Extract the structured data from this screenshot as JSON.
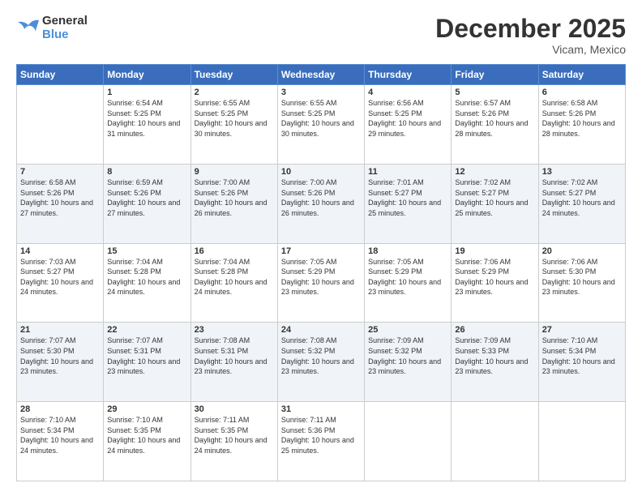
{
  "header": {
    "logo_general": "General",
    "logo_blue": "Blue",
    "month_title": "December 2025",
    "location": "Vicam, Mexico"
  },
  "days_of_week": [
    "Sunday",
    "Monday",
    "Tuesday",
    "Wednesday",
    "Thursday",
    "Friday",
    "Saturday"
  ],
  "weeks": [
    [
      {
        "day": "",
        "sunrise": "",
        "sunset": "",
        "daylight": ""
      },
      {
        "day": "1",
        "sunrise": "Sunrise: 6:54 AM",
        "sunset": "Sunset: 5:25 PM",
        "daylight": "Daylight: 10 hours and 31 minutes."
      },
      {
        "day": "2",
        "sunrise": "Sunrise: 6:55 AM",
        "sunset": "Sunset: 5:25 PM",
        "daylight": "Daylight: 10 hours and 30 minutes."
      },
      {
        "day": "3",
        "sunrise": "Sunrise: 6:55 AM",
        "sunset": "Sunset: 5:25 PM",
        "daylight": "Daylight: 10 hours and 30 minutes."
      },
      {
        "day": "4",
        "sunrise": "Sunrise: 6:56 AM",
        "sunset": "Sunset: 5:25 PM",
        "daylight": "Daylight: 10 hours and 29 minutes."
      },
      {
        "day": "5",
        "sunrise": "Sunrise: 6:57 AM",
        "sunset": "Sunset: 5:26 PM",
        "daylight": "Daylight: 10 hours and 28 minutes."
      },
      {
        "day": "6",
        "sunrise": "Sunrise: 6:58 AM",
        "sunset": "Sunset: 5:26 PM",
        "daylight": "Daylight: 10 hours and 28 minutes."
      }
    ],
    [
      {
        "day": "7",
        "sunrise": "Sunrise: 6:58 AM",
        "sunset": "Sunset: 5:26 PM",
        "daylight": "Daylight: 10 hours and 27 minutes."
      },
      {
        "day": "8",
        "sunrise": "Sunrise: 6:59 AM",
        "sunset": "Sunset: 5:26 PM",
        "daylight": "Daylight: 10 hours and 27 minutes."
      },
      {
        "day": "9",
        "sunrise": "Sunrise: 7:00 AM",
        "sunset": "Sunset: 5:26 PM",
        "daylight": "Daylight: 10 hours and 26 minutes."
      },
      {
        "day": "10",
        "sunrise": "Sunrise: 7:00 AM",
        "sunset": "Sunset: 5:26 PM",
        "daylight": "Daylight: 10 hours and 26 minutes."
      },
      {
        "day": "11",
        "sunrise": "Sunrise: 7:01 AM",
        "sunset": "Sunset: 5:27 PM",
        "daylight": "Daylight: 10 hours and 25 minutes."
      },
      {
        "day": "12",
        "sunrise": "Sunrise: 7:02 AM",
        "sunset": "Sunset: 5:27 PM",
        "daylight": "Daylight: 10 hours and 25 minutes."
      },
      {
        "day": "13",
        "sunrise": "Sunrise: 7:02 AM",
        "sunset": "Sunset: 5:27 PM",
        "daylight": "Daylight: 10 hours and 24 minutes."
      }
    ],
    [
      {
        "day": "14",
        "sunrise": "Sunrise: 7:03 AM",
        "sunset": "Sunset: 5:27 PM",
        "daylight": "Daylight: 10 hours and 24 minutes."
      },
      {
        "day": "15",
        "sunrise": "Sunrise: 7:04 AM",
        "sunset": "Sunset: 5:28 PM",
        "daylight": "Daylight: 10 hours and 24 minutes."
      },
      {
        "day": "16",
        "sunrise": "Sunrise: 7:04 AM",
        "sunset": "Sunset: 5:28 PM",
        "daylight": "Daylight: 10 hours and 24 minutes."
      },
      {
        "day": "17",
        "sunrise": "Sunrise: 7:05 AM",
        "sunset": "Sunset: 5:29 PM",
        "daylight": "Daylight: 10 hours and 23 minutes."
      },
      {
        "day": "18",
        "sunrise": "Sunrise: 7:05 AM",
        "sunset": "Sunset: 5:29 PM",
        "daylight": "Daylight: 10 hours and 23 minutes."
      },
      {
        "day": "19",
        "sunrise": "Sunrise: 7:06 AM",
        "sunset": "Sunset: 5:29 PM",
        "daylight": "Daylight: 10 hours and 23 minutes."
      },
      {
        "day": "20",
        "sunrise": "Sunrise: 7:06 AM",
        "sunset": "Sunset: 5:30 PM",
        "daylight": "Daylight: 10 hours and 23 minutes."
      }
    ],
    [
      {
        "day": "21",
        "sunrise": "Sunrise: 7:07 AM",
        "sunset": "Sunset: 5:30 PM",
        "daylight": "Daylight: 10 hours and 23 minutes."
      },
      {
        "day": "22",
        "sunrise": "Sunrise: 7:07 AM",
        "sunset": "Sunset: 5:31 PM",
        "daylight": "Daylight: 10 hours and 23 minutes."
      },
      {
        "day": "23",
        "sunrise": "Sunrise: 7:08 AM",
        "sunset": "Sunset: 5:31 PM",
        "daylight": "Daylight: 10 hours and 23 minutes."
      },
      {
        "day": "24",
        "sunrise": "Sunrise: 7:08 AM",
        "sunset": "Sunset: 5:32 PM",
        "daylight": "Daylight: 10 hours and 23 minutes."
      },
      {
        "day": "25",
        "sunrise": "Sunrise: 7:09 AM",
        "sunset": "Sunset: 5:32 PM",
        "daylight": "Daylight: 10 hours and 23 minutes."
      },
      {
        "day": "26",
        "sunrise": "Sunrise: 7:09 AM",
        "sunset": "Sunset: 5:33 PM",
        "daylight": "Daylight: 10 hours and 23 minutes."
      },
      {
        "day": "27",
        "sunrise": "Sunrise: 7:10 AM",
        "sunset": "Sunset: 5:34 PM",
        "daylight": "Daylight: 10 hours and 23 minutes."
      }
    ],
    [
      {
        "day": "28",
        "sunrise": "Sunrise: 7:10 AM",
        "sunset": "Sunset: 5:34 PM",
        "daylight": "Daylight: 10 hours and 24 minutes."
      },
      {
        "day": "29",
        "sunrise": "Sunrise: 7:10 AM",
        "sunset": "Sunset: 5:35 PM",
        "daylight": "Daylight: 10 hours and 24 minutes."
      },
      {
        "day": "30",
        "sunrise": "Sunrise: 7:11 AM",
        "sunset": "Sunset: 5:35 PM",
        "daylight": "Daylight: 10 hours and 24 minutes."
      },
      {
        "day": "31",
        "sunrise": "Sunrise: 7:11 AM",
        "sunset": "Sunset: 5:36 PM",
        "daylight": "Daylight: 10 hours and 25 minutes."
      },
      {
        "day": "",
        "sunrise": "",
        "sunset": "",
        "daylight": ""
      },
      {
        "day": "",
        "sunrise": "",
        "sunset": "",
        "daylight": ""
      },
      {
        "day": "",
        "sunrise": "",
        "sunset": "",
        "daylight": ""
      }
    ]
  ]
}
